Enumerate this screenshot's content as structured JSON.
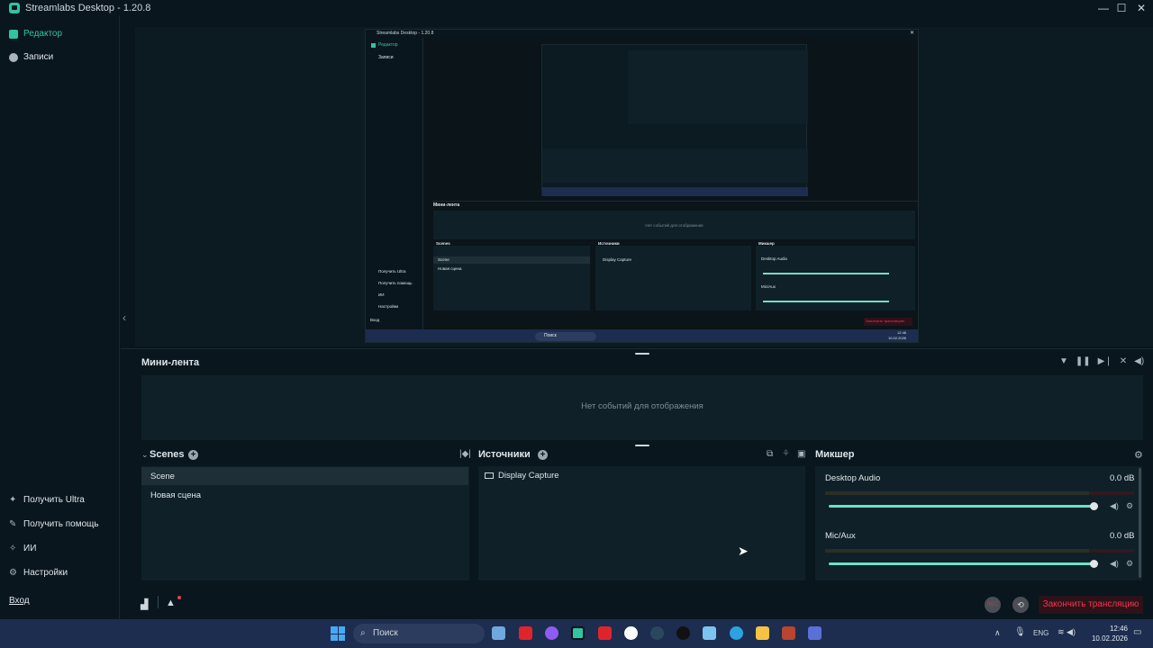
{
  "window": {
    "title": "Streamlabs Desktop - 1.20.8",
    "controls": {
      "minimize": "—",
      "maximize": "☐",
      "close": "✕"
    }
  },
  "nav": {
    "editor": "Редактор",
    "recordings": "Записи",
    "get_ultra": "Получить Ultra",
    "get_help": "Получить помощь",
    "ai": "ИИ",
    "settings": "Настройки",
    "login": "Вход"
  },
  "feed": {
    "title": "Мини-лента",
    "empty": "Нет событий для отображения"
  },
  "scenes": {
    "title": "Scenes",
    "items": [
      "Scene",
      "Новая сцена"
    ],
    "active_index": 0
  },
  "sources": {
    "title": "Источники",
    "items": [
      "Display Capture"
    ]
  },
  "mixer": {
    "title": "Микшер",
    "channels": [
      {
        "name": "Desktop Audio",
        "db": "0.0 dB",
        "level": 1.0
      },
      {
        "name": "Mic/Aux",
        "db": "0.0 dB",
        "level": 1.0
      }
    ]
  },
  "footer": {
    "rec_label": "REC",
    "end_stream": "Закончить трансляцию"
  },
  "nested_preview": {
    "title": "Streamlabs Desktop - 1.20.8",
    "feed_title": "Мини-лента",
    "feed_empty": "Нет событий для отображения",
    "search": "Поиск",
    "time": "12:46",
    "date": "10.02.2026"
  },
  "taskbar": {
    "search_placeholder": "Поиск",
    "lang": "ENG",
    "time": "12:46",
    "date": "10.02.2026"
  },
  "colors": {
    "accent": "#31c3a2",
    "background": "#09161d",
    "panel": "#0f2028",
    "end_stream_text": "#f2384e",
    "taskbar": "#1c2d4f"
  }
}
